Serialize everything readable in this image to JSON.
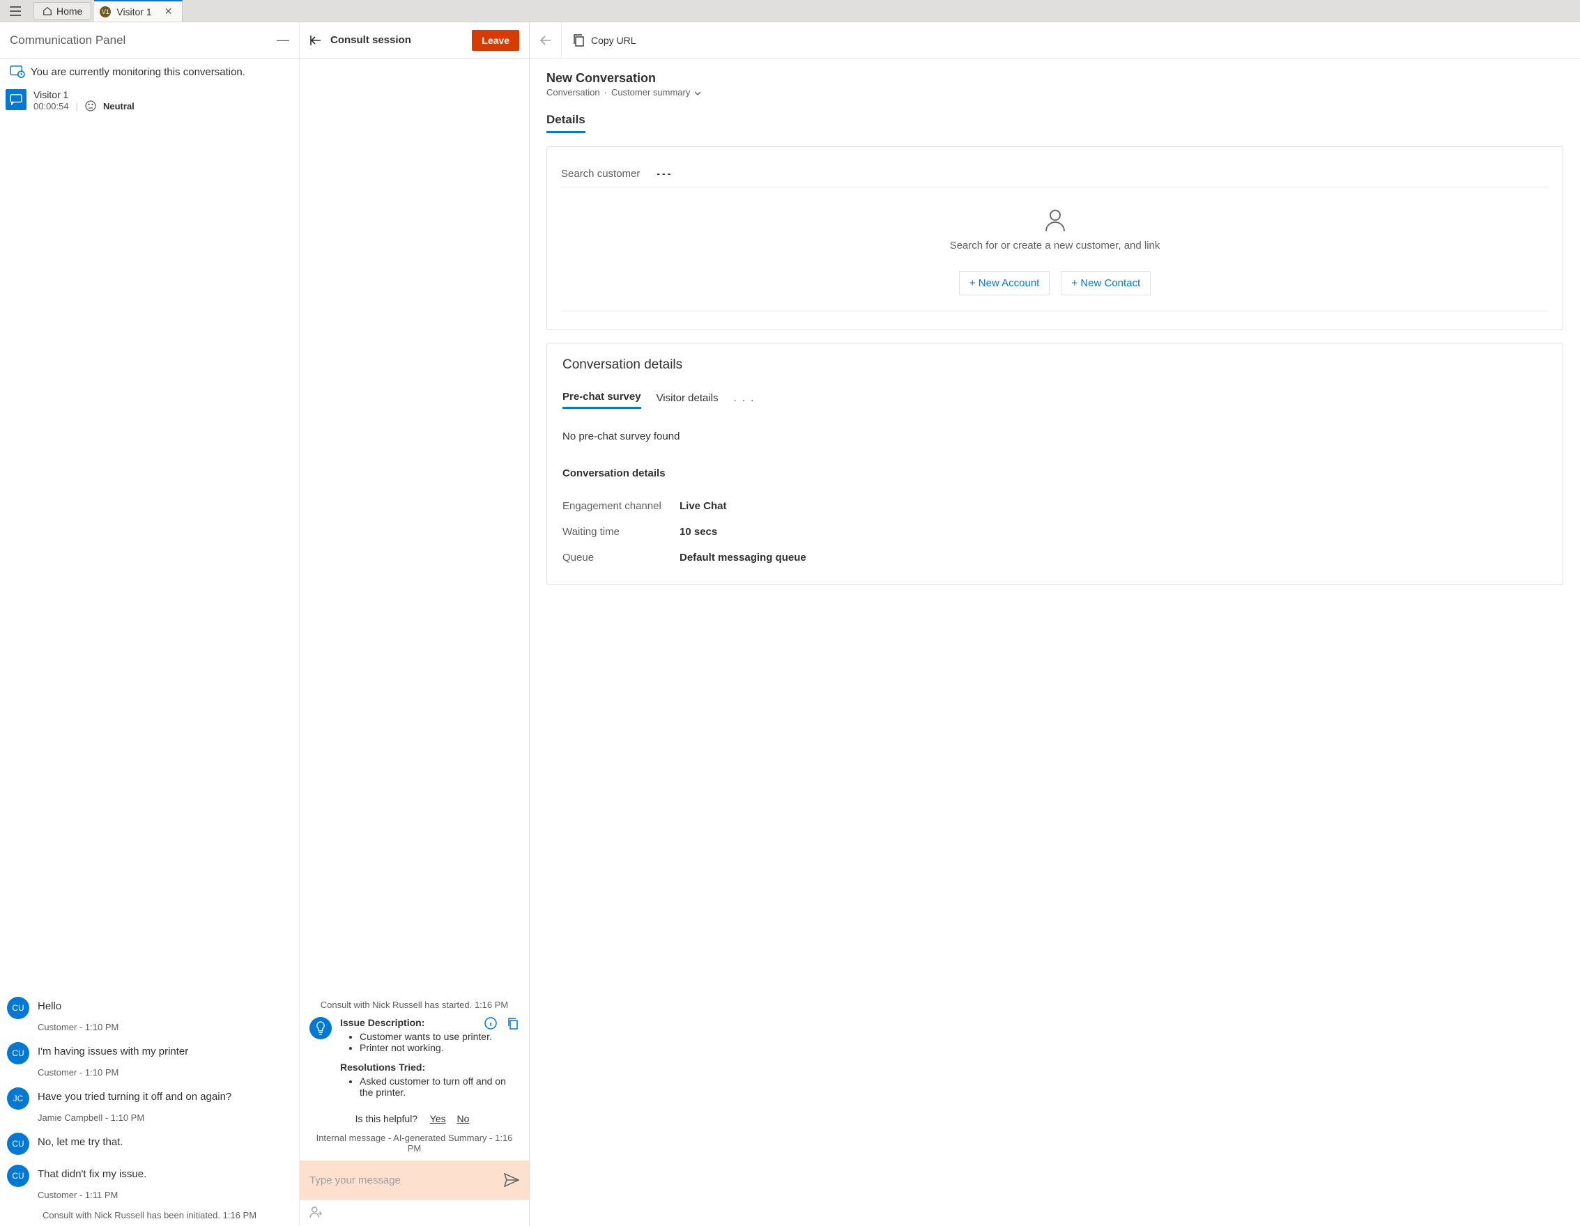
{
  "topbar": {
    "home_label": "Home",
    "visitor_badge": "V1",
    "visitor_tab_label": "Visitor 1"
  },
  "comm_panel": {
    "title": "Communication Panel",
    "monitoring_msg": "You are currently monitoring this conversation.",
    "session_name": "Visitor 1",
    "session_timer": "00:00:54",
    "sentiment": "Neutral"
  },
  "chat": [
    {
      "avatar": "CU",
      "text": "Hello",
      "meta": "Customer - 1:10 PM"
    },
    {
      "avatar": "CU",
      "text": "I'm having issues with my printer",
      "meta": "Customer - 1:10 PM"
    },
    {
      "avatar": "JC",
      "text": "Have you tried turning it off and on again?",
      "meta": "Jamie Campbell - 1:10 PM"
    },
    {
      "avatar": "CU",
      "text": "No, let me try that.",
      "meta": ""
    },
    {
      "avatar": "CU",
      "text": "That didn't fix my issue.",
      "meta": "Customer - 1:11 PM"
    }
  ],
  "chat_system": "Consult with Nick Russell has been initiated. 1:16 PM",
  "consult": {
    "title": "Consult session",
    "leave_label": "Leave",
    "started_msg": "Consult with Nick Russell has started. 1:16 PM",
    "issue_heading": "Issue Description:",
    "issues": [
      "Customer wants to use printer.",
      "Printer not working."
    ],
    "resolutions_heading": "Resolutions Tried:",
    "resolutions": [
      "Asked customer to turn off and on the printer."
    ],
    "helpful_q": "Is this helpful?",
    "yes": "Yes",
    "no": "No",
    "ai_meta": "Internal message - AI-generated Summary - 1:16 PM",
    "compose_placeholder": "Type your message"
  },
  "right": {
    "copy_label": "Copy URL",
    "title": "New Conversation",
    "entity": "Conversation",
    "form": "Customer summary",
    "tab_details": "Details",
    "search_cust_label": "Search customer",
    "search_cust_value": "---",
    "empty_cust_msg": "Search for or create a new customer, and link",
    "new_account": "+ New Account",
    "new_contact": "+ New Contact",
    "conv_card_title": "Conversation details",
    "subtab_prechat": "Pre-chat survey",
    "subtab_visitor": "Visitor details",
    "more": ". . .",
    "no_prechat": "No pre-chat survey found",
    "detail_head": "Conversation details",
    "rows": [
      {
        "k": "Engagement channel",
        "v": "Live Chat"
      },
      {
        "k": "Waiting time",
        "v": "10 secs"
      },
      {
        "k": "Queue",
        "v": "Default messaging queue"
      }
    ]
  }
}
